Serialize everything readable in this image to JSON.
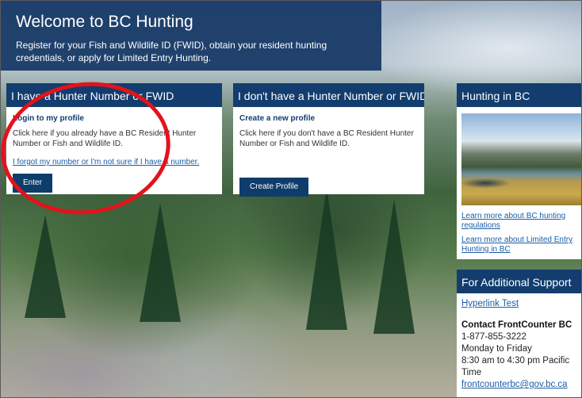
{
  "welcome": {
    "title": "Welcome to BC Hunting",
    "description": "Register for your Fish and Wildlife ID (FWID), obtain your resident hunting credentials, or apply for Limited Entry Hunting."
  },
  "login_card": {
    "heading": "I have a Hunter Number or FWID",
    "subheading": "Login to my profile",
    "text": "Click here if you already have a BC Resident Hunter Number or Fish and Wildlife ID.",
    "forgot_link": "I forgot my number or I'm not sure if I have a number.",
    "button": "Enter"
  },
  "create_card": {
    "heading": "I don't have a Hunter Number or FWID",
    "subheading": "Create a new profile",
    "text": "Click here if you don't have a BC Resident Hunter Number or Fish and Wildlife ID.",
    "button": "Create Profile"
  },
  "hunting_panel": {
    "heading": "Hunting in BC",
    "links": [
      "Learn more about BC hunting regulations",
      "Learn more about Limited Entry Hunting in BC"
    ]
  },
  "support_panel": {
    "heading": "For Additional Support",
    "test_link": "Hyperlink Test",
    "contact_title": "Contact FrontCounter BC",
    "phone": "1-877-855-3222",
    "days": "Monday to Friday",
    "hours": "8:30 am to 4:30 pm Pacific Time",
    "email": "frontcounterbc@gov.bc.ca"
  },
  "colors": {
    "header_blue": "#123d6e",
    "button_blue": "#0f3d6b",
    "link_blue": "#1a5ea6",
    "annotation_red": "#e4121b"
  }
}
